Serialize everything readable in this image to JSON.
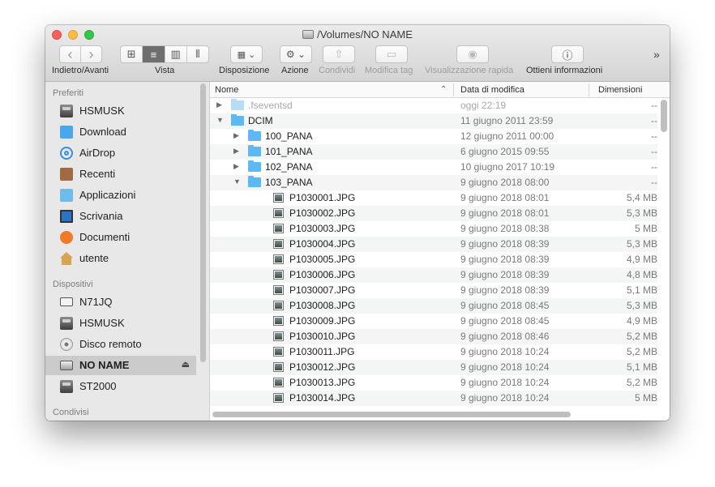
{
  "window": {
    "title": "/Volumes/NO NAME"
  },
  "toolbar": {
    "nav_back": "‹",
    "nav_forward": "›",
    "nav_label": "Indietro/Avanti",
    "view_label": "Vista",
    "arrange_label": "Disposizione",
    "action_label": "Azione",
    "share_label": "Condividi",
    "tags_label": "Modifica tag",
    "quicklook_label": "Visualizzazione rapida",
    "info_label": "Ottieni informazioni",
    "overflow": "»",
    "view_icons": [
      "⊞",
      "≡",
      "▥",
      "⫴"
    ],
    "arrange_icon": "▦ ⌄",
    "action_icon": "⚙ ⌄",
    "share_icon": "⇧",
    "tags_icon": "▭",
    "quicklook_icon": "◉",
    "info_icon": "ⓘ"
  },
  "sidebar": {
    "sections": [
      {
        "header": "Preferiti",
        "items": [
          {
            "label": "HSMUSK",
            "icon": "drive-icon"
          },
          {
            "label": "Download",
            "icon": "downloads-folder-icon"
          },
          {
            "label": "AirDrop",
            "icon": "airdrop-icon"
          },
          {
            "label": "Recenti",
            "icon": "recents-icon"
          },
          {
            "label": "Applicazioni",
            "icon": "applications-icon"
          },
          {
            "label": "Scrivania",
            "icon": "desktop-icon"
          },
          {
            "label": "Documenti",
            "icon": "documents-icon"
          },
          {
            "label": "utente",
            "icon": "home-icon"
          }
        ]
      },
      {
        "header": "Dispositivi",
        "items": [
          {
            "label": "N71JQ",
            "icon": "laptop-icon"
          },
          {
            "label": "HSMUSK",
            "icon": "drive-icon"
          },
          {
            "label": "Disco remoto",
            "icon": "remote-disc-icon"
          },
          {
            "label": "NO NAME",
            "icon": "volume-icon",
            "selected": true,
            "eject": "⏏"
          },
          {
            "label": "ST2000",
            "icon": "drive-icon"
          }
        ]
      },
      {
        "header": "Condivisi",
        "items": []
      }
    ]
  },
  "columns": {
    "name": "Nome",
    "date": "Data di modifica",
    "size": "Dimensioni",
    "sort_indicator": "⌃"
  },
  "files": [
    {
      "name": ".fseventsd",
      "date": "oggi 22:19",
      "size": "--",
      "kind": "folder",
      "level": 0,
      "expanded": false,
      "faded": true
    },
    {
      "name": "DCIM",
      "date": "11 giugno 2011 23:59",
      "size": "--",
      "kind": "folder",
      "level": 0,
      "expanded": true
    },
    {
      "name": "100_PANA",
      "date": "12 giugno 2011 00:00",
      "size": "--",
      "kind": "folder",
      "level": 1,
      "expanded": false
    },
    {
      "name": "101_PANA",
      "date": "6 giugno 2015 09:55",
      "size": "--",
      "kind": "folder",
      "level": 1,
      "expanded": false
    },
    {
      "name": "102_PANA",
      "date": "10 giugno 2017 10:19",
      "size": "--",
      "kind": "folder",
      "level": 1,
      "expanded": false
    },
    {
      "name": "103_PANA",
      "date": "9 giugno 2018 08:00",
      "size": "--",
      "kind": "folder",
      "level": 1,
      "expanded": true
    },
    {
      "name": "P1030001.JPG",
      "date": "9 giugno 2018 08:01",
      "size": "5,4 MB",
      "kind": "image",
      "level": 2
    },
    {
      "name": "P1030002.JPG",
      "date": "9 giugno 2018 08:01",
      "size": "5,3 MB",
      "kind": "image",
      "level": 2
    },
    {
      "name": "P1030003.JPG",
      "date": "9 giugno 2018 08:38",
      "size": "5 MB",
      "kind": "image",
      "level": 2
    },
    {
      "name": "P1030004.JPG",
      "date": "9 giugno 2018 08:39",
      "size": "5,3 MB",
      "kind": "image",
      "level": 2
    },
    {
      "name": "P1030005.JPG",
      "date": "9 giugno 2018 08:39",
      "size": "4,9 MB",
      "kind": "image",
      "level": 2
    },
    {
      "name": "P1030006.JPG",
      "date": "9 giugno 2018 08:39",
      "size": "4,8 MB",
      "kind": "image",
      "level": 2
    },
    {
      "name": "P1030007.JPG",
      "date": "9 giugno 2018 08:39",
      "size": "5,1 MB",
      "kind": "image",
      "level": 2
    },
    {
      "name": "P1030008.JPG",
      "date": "9 giugno 2018 08:45",
      "size": "5,3 MB",
      "kind": "image",
      "level": 2
    },
    {
      "name": "P1030009.JPG",
      "date": "9 giugno 2018 08:45",
      "size": "4,9 MB",
      "kind": "image",
      "level": 2
    },
    {
      "name": "P1030010.JPG",
      "date": "9 giugno 2018 08:46",
      "size": "5,2 MB",
      "kind": "image",
      "level": 2
    },
    {
      "name": "P1030011.JPG",
      "date": "9 giugno 2018 10:24",
      "size": "5,2 MB",
      "kind": "image",
      "level": 2
    },
    {
      "name": "P1030012.JPG",
      "date": "9 giugno 2018 10:24",
      "size": "5,1 MB",
      "kind": "image",
      "level": 2
    },
    {
      "name": "P1030013.JPG",
      "date": "9 giugno 2018 10:24",
      "size": "5,2 MB",
      "kind": "image",
      "level": 2
    },
    {
      "name": "P1030014.JPG",
      "date": "9 giugno 2018 10:24",
      "size": "5 MB",
      "kind": "image",
      "level": 2
    }
  ]
}
